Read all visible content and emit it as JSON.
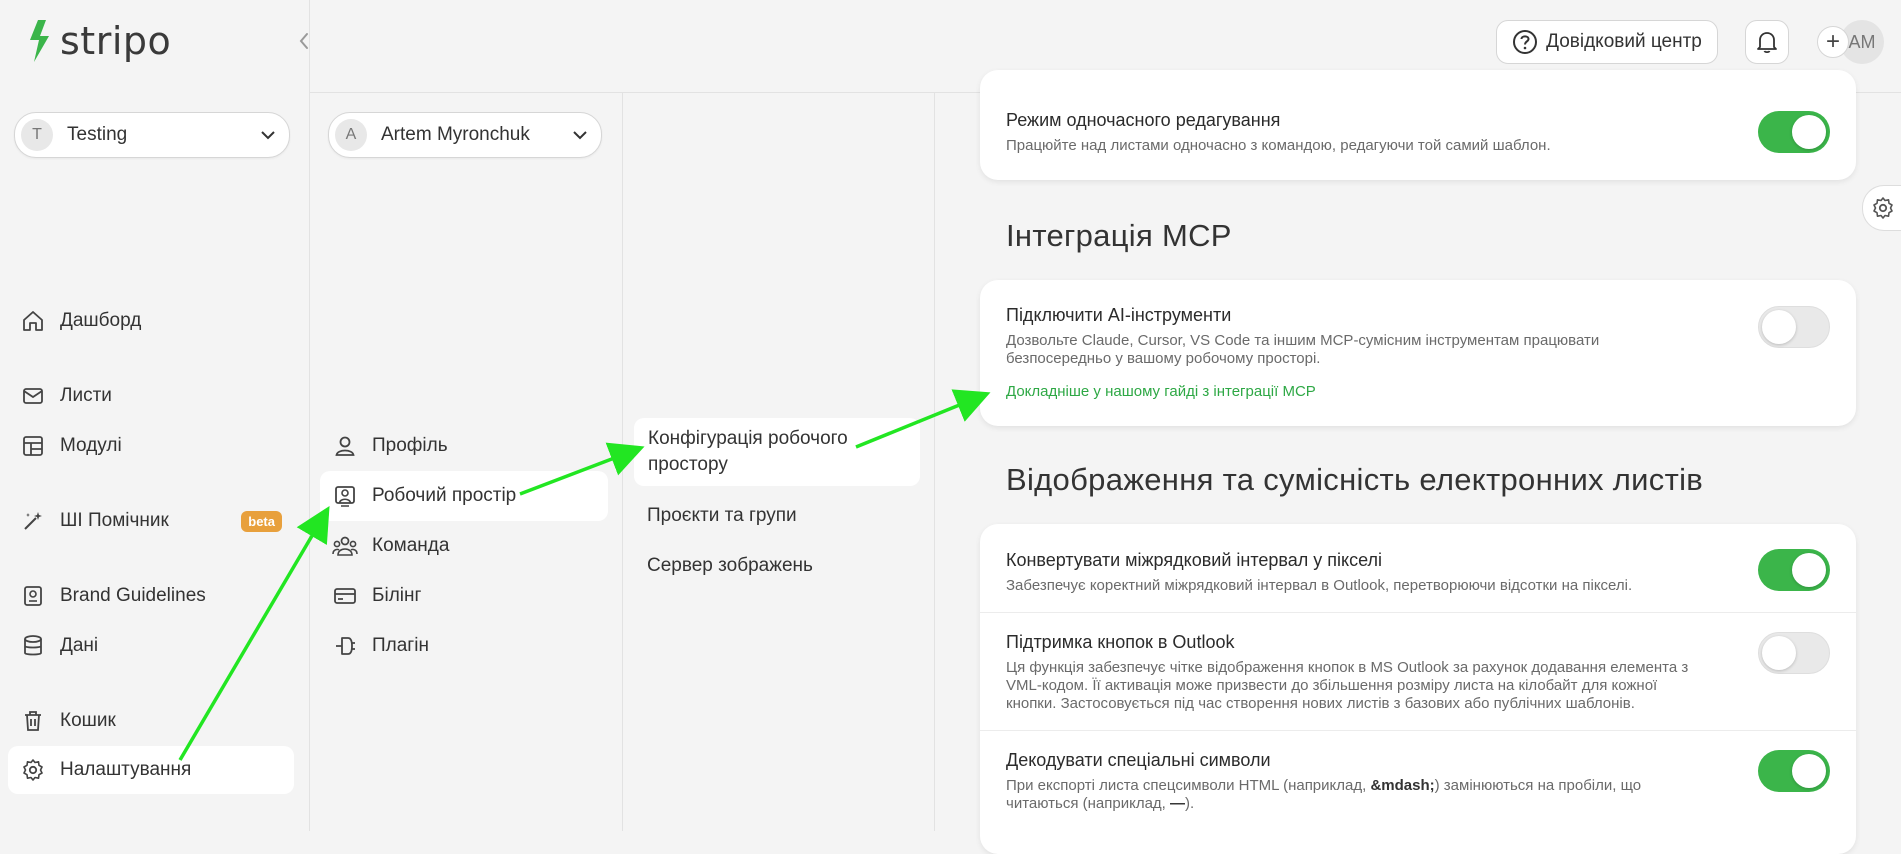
{
  "app": {
    "logo_text": "stripo"
  },
  "project_selector": {
    "avatar": "T",
    "label": "Testing"
  },
  "user_selector": {
    "avatar": "A",
    "label": "Artem Myronchuk"
  },
  "sidebar": {
    "items": [
      {
        "label": "Дашборд",
        "icon": "home-icon"
      },
      {
        "label": "Листи",
        "icon": "mail-icon"
      },
      {
        "label": "Модулі",
        "icon": "modules-icon"
      },
      {
        "label": "ШІ Помічник",
        "icon": "magic-wand-icon",
        "badge": "beta"
      },
      {
        "label": "Brand Guidelines",
        "icon": "brand-book-icon"
      },
      {
        "label": "Дані",
        "icon": "database-icon"
      },
      {
        "label": "Кошик",
        "icon": "trash-icon"
      },
      {
        "label": "Налаштування",
        "icon": "gear-icon",
        "active": true
      }
    ]
  },
  "settings_menu": {
    "items": [
      {
        "label": "Профіль",
        "icon": "user-icon"
      },
      {
        "label": "Робочий простір",
        "icon": "workspace-icon",
        "active": true
      },
      {
        "label": "Команда",
        "icon": "team-icon"
      },
      {
        "label": "Білінг",
        "icon": "card-icon"
      },
      {
        "label": "Плагін",
        "icon": "plug-icon"
      }
    ]
  },
  "workspace_menu": {
    "items": [
      {
        "label": "Конфігурація робочого простору",
        "active": true
      },
      {
        "label": "Проєкти та групи"
      },
      {
        "label": "Сервер зображень"
      }
    ]
  },
  "header": {
    "help_label": "Довідковий центр",
    "user_initials": "AM",
    "plus_label": "+"
  },
  "content": {
    "coediting": {
      "title": "Режим одночасного редагування",
      "desc": "Працюйте над листами одночасно з командою, редагуючи той самий шаблон.",
      "enabled": true
    },
    "mcp_section": {
      "heading": "Інтеграція MCP",
      "title": "Підключити AI-інструменти",
      "desc": "Дозвольте Claude, Cursor, VS Code та іншим MCP-сумісним інструментам працювати безпосередньо у вашому робочому просторі.",
      "link": "Докладніше у нашому гайді з інтеграції MCP",
      "enabled": false
    },
    "email_section": {
      "heading": "Відображення та сумісність електронних листів",
      "rows": [
        {
          "title": "Конвертувати міжрядковий інтервал у пікселі",
          "desc": "Забезпечує коректний міжрядковий інтервал в Outlook, перетворюючи відсотки на пікселі.",
          "enabled": true
        },
        {
          "title": "Підтримка кнопок в Outlook",
          "desc": "Ця функція забезпечує чітке відображення кнопок в MS Outlook за рахунок додавання елемента з VML-кодом. Її активація може призвести до збільшення розміру листа на кілобайт для кожної кнопки. Застосовується під час створення нових листів з базових або публічних шаблонів.",
          "enabled": false
        },
        {
          "title": "Декодувати спеціальні символи",
          "desc_pre": "При експорті листа спецсимволи HTML (наприклад, ",
          "desc_code1": "&mdash;",
          "desc_mid": ") замінюються на пробіли, що читаються (наприклад, ",
          "desc_code2": "—",
          "desc_post": ").",
          "enabled": true
        }
      ]
    }
  },
  "colors": {
    "accent": "#3bb54a",
    "annotation_arrow": "#22e622",
    "beta_badge": "#e8a03c"
  }
}
